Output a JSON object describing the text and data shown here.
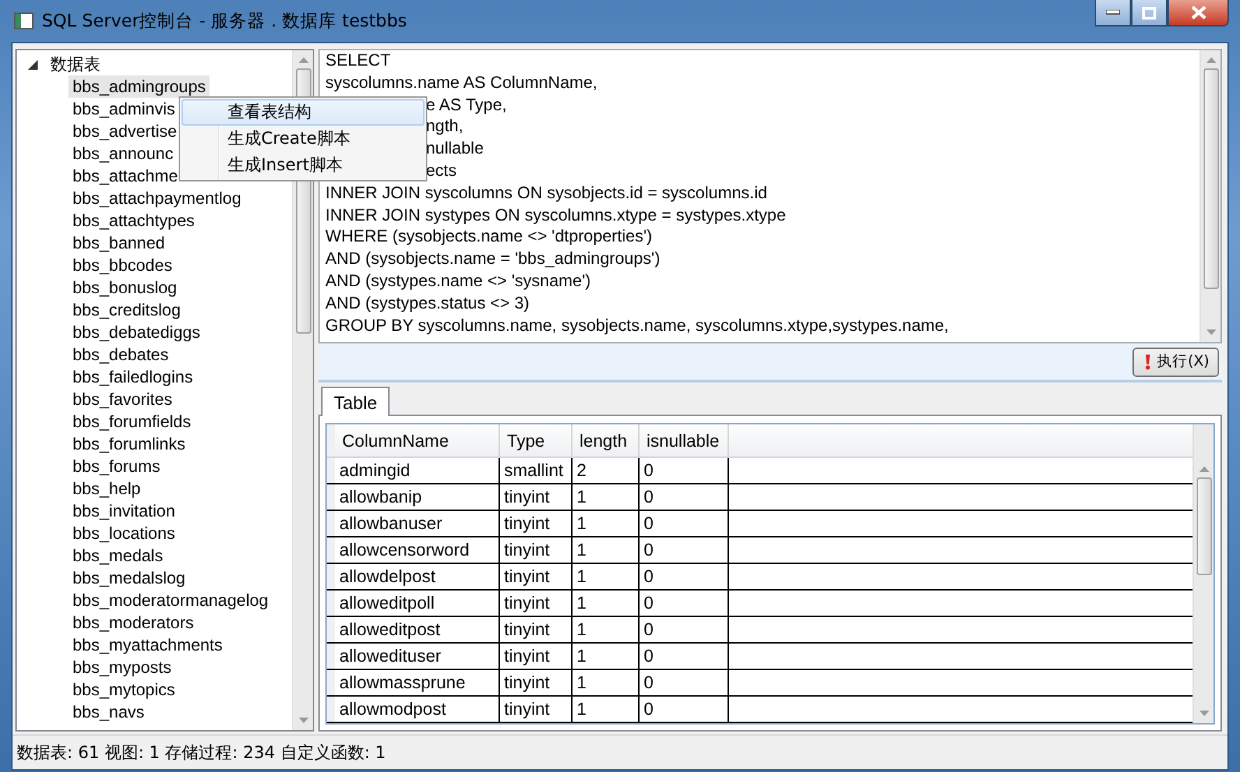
{
  "window": {
    "title": "SQL Server控制台 - 服务器 . 数据库 testbbs"
  },
  "tree": {
    "root": {
      "label": "数据表",
      "expanded": true,
      "children": [
        {
          "label": "bbs_admingroups",
          "selected": true
        },
        {
          "label": "bbs_adminvis",
          "selected": false
        },
        {
          "label": "bbs_advertise",
          "selected": false
        },
        {
          "label": "bbs_announc",
          "selected": false
        },
        {
          "label": "bbs_attachme",
          "selected": false
        },
        {
          "label": "bbs_attachpaymentlog",
          "selected": false
        },
        {
          "label": "bbs_attachtypes",
          "selected": false
        },
        {
          "label": "bbs_banned",
          "selected": false
        },
        {
          "label": "bbs_bbcodes",
          "selected": false
        },
        {
          "label": "bbs_bonuslog",
          "selected": false
        },
        {
          "label": "bbs_creditslog",
          "selected": false
        },
        {
          "label": "bbs_debatediggs",
          "selected": false
        },
        {
          "label": "bbs_debates",
          "selected": false
        },
        {
          "label": "bbs_failedlogins",
          "selected": false
        },
        {
          "label": "bbs_favorites",
          "selected": false
        },
        {
          "label": "bbs_forumfields",
          "selected": false
        },
        {
          "label": "bbs_forumlinks",
          "selected": false
        },
        {
          "label": "bbs_forums",
          "selected": false
        },
        {
          "label": "bbs_help",
          "selected": false
        },
        {
          "label": "bbs_invitation",
          "selected": false
        },
        {
          "label": "bbs_locations",
          "selected": false
        },
        {
          "label": "bbs_medals",
          "selected": false
        },
        {
          "label": "bbs_medalslog",
          "selected": false
        },
        {
          "label": "bbs_moderatormanagelog",
          "selected": false
        },
        {
          "label": "bbs_moderators",
          "selected": false
        },
        {
          "label": "bbs_myattachments",
          "selected": false
        },
        {
          "label": "bbs_myposts",
          "selected": false
        },
        {
          "label": "bbs_mytopics",
          "selected": false
        },
        {
          "label": "bbs_navs",
          "selected": false
        }
      ]
    }
  },
  "context_menu": {
    "items": [
      {
        "label": "查看表结构",
        "selected": true
      },
      {
        "label": "生成Create脚本",
        "selected": false
      },
      {
        "label": "生成Insert脚本",
        "selected": false
      }
    ]
  },
  "sql_editor": {
    "lines": [
      {
        "text": "SELECT"
      },
      {
        "text": "syscolumns.name AS ColumnName,"
      },
      {
        "text": "e AS Type,",
        "partly_hidden": true
      },
      {
        "text": "ngth,",
        "partly_hidden": true
      },
      {
        "text": "nullable",
        "partly_hidden": true
      },
      {
        "text": "ects",
        "partly_hidden": true
      },
      {
        "text": "INNER JOIN syscolumns ON sysobjects.id = syscolumns.id"
      },
      {
        "text": "INNER JOIN systypes ON syscolumns.xtype = systypes.xtype"
      },
      {
        "text": "WHERE (sysobjects.name <> 'dtproperties')"
      },
      {
        "text": "AND (sysobjects.name = 'bbs_admingroups')"
      },
      {
        "text": "AND (systypes.name <> 'sysname')"
      },
      {
        "text": "AND (systypes.status <> 3)"
      },
      {
        "text": "GROUP BY syscolumns.name, sysobjects.name, syscolumns.xtype,systypes.name,"
      }
    ]
  },
  "execute_button": {
    "label": "执行(X)"
  },
  "tabs": [
    {
      "label": "Table",
      "selected": true
    }
  ],
  "table": {
    "columns": [
      "ColumnName",
      "Type",
      "length",
      "isnullable"
    ],
    "rows": [
      [
        "admingid",
        "smallint",
        "2",
        "0"
      ],
      [
        "allowbanip",
        "tinyint",
        "1",
        "0"
      ],
      [
        "allowbanuser",
        "tinyint",
        "1",
        "0"
      ],
      [
        "allowcensorword",
        "tinyint",
        "1",
        "0"
      ],
      [
        "allowdelpost",
        "tinyint",
        "1",
        "0"
      ],
      [
        "alloweditpoll",
        "tinyint",
        "1",
        "0"
      ],
      [
        "alloweditpost",
        "tinyint",
        "1",
        "0"
      ],
      [
        "allowedituser",
        "tinyint",
        "1",
        "0"
      ],
      [
        "allowmassprune",
        "tinyint",
        "1",
        "0"
      ],
      [
        "allowmodpost",
        "tinyint",
        "1",
        "0"
      ]
    ]
  },
  "status_bar": "数据表: 61 视图: 1 存储过程: 234 自定义函数: 1"
}
